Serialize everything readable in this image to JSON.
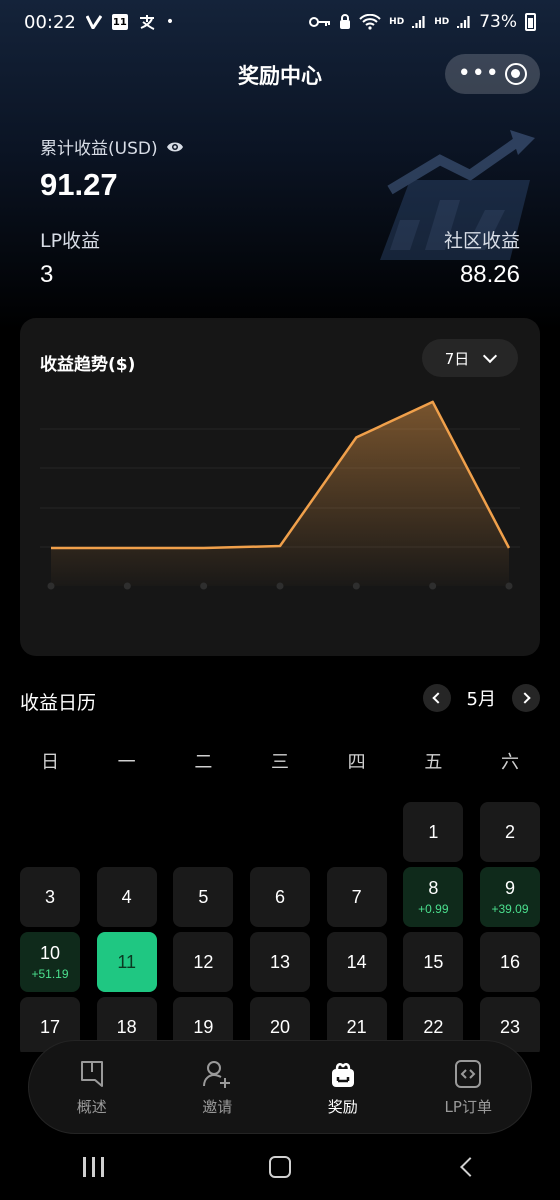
{
  "status_bar": {
    "time": "00:22",
    "notifications": [
      "v-icon",
      "calendar-11-icon",
      "alipay-icon",
      "dot-icon"
    ],
    "calendar_day": "11",
    "right_icons": [
      "key-icon",
      "lock-icon",
      "wifi-icon",
      "hd-signal-icon",
      "hd-signal-icon"
    ],
    "hd": "HD",
    "battery": "73%"
  },
  "header": {
    "title": "奖励中心"
  },
  "earnings": {
    "total_label": "累计收益(USD)",
    "total_value": "91.27",
    "lp_label": "LP收益",
    "lp_value": "3",
    "community_label": "社区收益",
    "community_value": "88.26"
  },
  "chart": {
    "title": "收益趋势($)",
    "range": "7日"
  },
  "chart_data": {
    "type": "area",
    "title": "收益趋势($)",
    "x": [
      1,
      2,
      3,
      4,
      5,
      6,
      7
    ],
    "values": [
      0,
      0,
      0,
      0.5,
      28,
      37,
      0
    ],
    "ylim": [
      0,
      40
    ],
    "grid": true,
    "color": "#f0a04b"
  },
  "calendar": {
    "title": "收益日历",
    "month": "5月",
    "weekdays": [
      "日",
      "一",
      "二",
      "三",
      "四",
      "五",
      "六"
    ],
    "today": 11,
    "earned_days": {
      "8": "+0.99",
      "9": "+39.09",
      "10": "+51.19"
    }
  },
  "tabs": [
    {
      "label": "概述",
      "icon": "bookmark-doc-icon",
      "active": false
    },
    {
      "label": "邀请",
      "icon": "add-user-icon",
      "active": false
    },
    {
      "label": "奖励",
      "icon": "gift-box-icon",
      "active": true
    },
    {
      "label": "LP订单",
      "icon": "code-file-icon",
      "active": false
    }
  ],
  "colors": {
    "accent": "#1fc782",
    "chart_line": "#f0a04b",
    "earned_text": "#4be08e"
  }
}
